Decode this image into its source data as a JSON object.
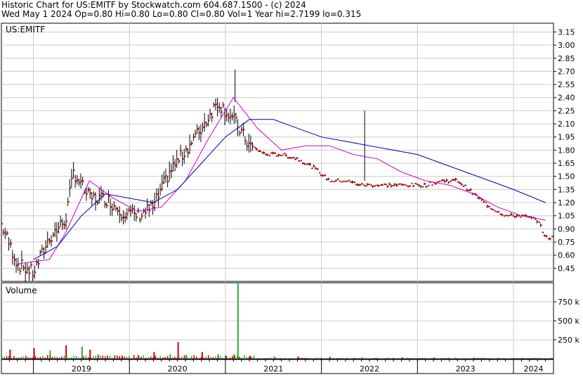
{
  "header": {
    "line1": "Historic Chart for US:EMITF by Stockwatch.com 604.687.1500 - (c) 2024",
    "line2": "Wed May  1 2024   Op=0.80  Hi=0.80  Lo=0.80  Cl=0.80  Vol=1   Year hi=2.7199   lo=0.315"
  },
  "colors": {
    "price_bar": "#000000",
    "price_close_dot": "#cc0000",
    "ma_short": "#cc00cc",
    "ma_long": "#0000aa",
    "volume_up": "#33aa33",
    "volume_down": "#cc0000",
    "grid": "#cccccc"
  },
  "chart_data": [
    {
      "type": "line",
      "panel": "price",
      "title": "US:EMITF",
      "ylabel": "",
      "x_ticks": [
        "2019",
        "2020",
        "2021",
        "2022",
        "2023",
        "2024"
      ],
      "y_ticks": [
        "3.15",
        "3.00",
        "2.85",
        "2.70",
        "2.55",
        "2.40",
        "2.25",
        "2.10",
        "1.95",
        "1.80",
        "1.65",
        "1.50",
        "1.35",
        "1.20",
        "1.05",
        "0.90",
        "0.75",
        "0.60",
        "0.45"
      ],
      "ylim": [
        0.3,
        3.25
      ],
      "grid": true,
      "x_range": [
        "2018-09",
        "2024-05"
      ],
      "price_keypoints": {
        "x": [
          "2018-09",
          "2018-11",
          "2019-01",
          "2019-03",
          "2019-05",
          "2019-06",
          "2019-08",
          "2019-10",
          "2019-12",
          "2020-02",
          "2020-04",
          "2020-06",
          "2020-08",
          "2020-10",
          "2020-12",
          "2021-02",
          "2021-04",
          "2021-06",
          "2021-08",
          "2021-10",
          "2021-12",
          "2022-02",
          "2022-04",
          "2022-06",
          "2022-08",
          "2022-10",
          "2022-12",
          "2023-02",
          "2023-04",
          "2023-06",
          "2023-08",
          "2023-10",
          "2023-12",
          "2024-02",
          "2024-04",
          "2024-05"
        ],
        "close": [
          0.95,
          0.5,
          0.4,
          0.8,
          1.0,
          1.55,
          1.25,
          1.25,
          1.1,
          1.05,
          1.15,
          1.55,
          1.8,
          2.05,
          2.35,
          2.15,
          1.85,
          1.75,
          1.75,
          1.7,
          1.6,
          1.45,
          1.45,
          1.4,
          1.4,
          1.4,
          1.4,
          1.4,
          1.45,
          1.45,
          1.3,
          1.15,
          1.05,
          1.05,
          1.0,
          0.8
        ]
      },
      "series": [
        {
          "name": "",
          "role": "short moving average",
          "color": "#cc00cc",
          "x": [
            "2018-11",
            "2019-03",
            "2019-05",
            "2019-08",
            "2019-11",
            "2020-02",
            "2020-05",
            "2020-08",
            "2020-11",
            "2021-02",
            "2021-05",
            "2021-08",
            "2021-11",
            "2022-02",
            "2022-05",
            "2022-08",
            "2022-11",
            "2023-02",
            "2023-05",
            "2023-08",
            "2023-11",
            "2024-02",
            "2024-05"
          ],
          "values": [
            0.5,
            0.55,
            0.85,
            1.45,
            1.25,
            1.1,
            1.15,
            1.45,
            1.95,
            2.4,
            2.05,
            1.8,
            1.85,
            1.85,
            1.75,
            1.7,
            1.55,
            1.45,
            1.4,
            1.3,
            1.15,
            1.05,
            1.0
          ]
        },
        {
          "name": "",
          "role": "long moving average",
          "color": "#0000aa",
          "x": [
            "2019-01",
            "2019-04",
            "2019-07",
            "2019-10",
            "2020-01",
            "2020-04",
            "2020-07",
            "2020-10",
            "2021-01",
            "2021-04",
            "2021-07",
            "2021-10",
            "2022-01",
            "2022-04",
            "2022-07",
            "2022-10",
            "2023-01",
            "2023-04",
            "2023-07",
            "2023-10",
            "2024-01",
            "2024-05"
          ],
          "values": [
            0.55,
            0.7,
            1.05,
            1.3,
            1.25,
            1.2,
            1.35,
            1.65,
            1.95,
            2.15,
            2.15,
            2.05,
            1.95,
            1.9,
            1.85,
            1.8,
            1.75,
            1.65,
            1.55,
            1.45,
            1.35,
            1.2
          ]
        }
      ]
    },
    {
      "type": "bar",
      "panel": "volume",
      "title": "Volume",
      "y_ticks": [
        "750 k",
        "500 k",
        "250 k"
      ],
      "ylim": [
        0,
        1000
      ],
      "grid": true,
      "bars": {
        "x": [
          "2018-10",
          "2019-01",
          "2019-03",
          "2019-05",
          "2019-07",
          "2019-08",
          "2019-09",
          "2019-12",
          "2020-02",
          "2020-04",
          "2020-06",
          "2020-07",
          "2020-08",
          "2020-10",
          "2020-12",
          "2021-01",
          "2021-02",
          "2021-02b",
          "2021-04",
          "2021-07",
          "2021-10",
          "2022-02",
          "2022-06",
          "2022-11",
          "2023-03",
          "2023-08",
          "2024-02"
        ],
        "values": [
          120,
          140,
          110,
          180,
          160,
          120,
          60,
          40,
          50,
          90,
          60,
          220,
          50,
          90,
          60,
          40,
          60,
          1000,
          40,
          30,
          30,
          25,
          20,
          20,
          20,
          15,
          15
        ],
        "colors": [
          "r",
          "r",
          "g",
          "r",
          "g",
          "r",
          "g",
          "r",
          "g",
          "r",
          "g",
          "r",
          "g",
          "r",
          "g",
          "r",
          "g",
          "g",
          "r",
          "g",
          "r",
          "r",
          "g",
          "r",
          "g",
          "r",
          "g"
        ]
      }
    }
  ]
}
